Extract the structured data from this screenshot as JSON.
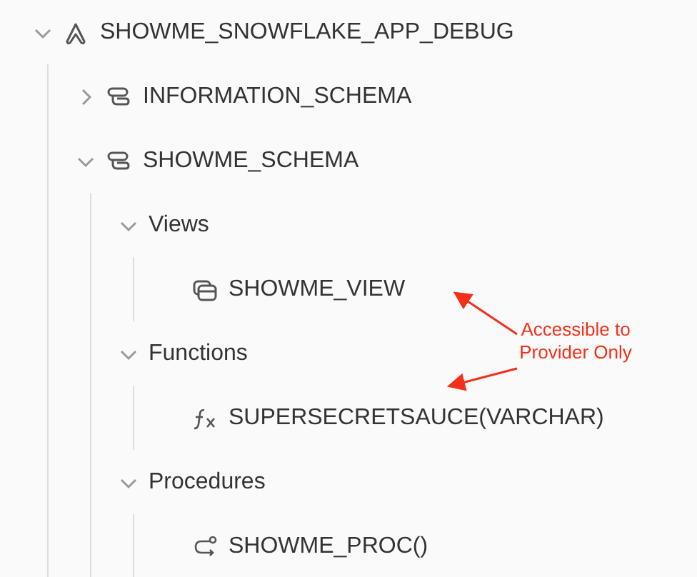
{
  "tree": [
    {
      "label": "SHOWME_SNOWFLAKE_APP_DEBUG",
      "kind": "app",
      "expanded": true,
      "children": [
        {
          "label": "INFORMATION_SCHEMA",
          "kind": "schema",
          "expanded": false
        },
        {
          "label": "SHOWME_SCHEMA",
          "kind": "schema",
          "expanded": true,
          "children": [
            {
              "label": "Views",
              "kind": "category",
              "expanded": true,
              "children": [
                {
                  "label": "SHOWME_VIEW",
                  "kind": "view"
                }
              ]
            },
            {
              "label": "Functions",
              "kind": "category",
              "expanded": true,
              "children": [
                {
                  "label": "SUPERSECRETSAUCE(VARCHAR)",
                  "kind": "function"
                }
              ]
            },
            {
              "label": "Procedures",
              "kind": "category",
              "expanded": true,
              "children": [
                {
                  "label": "SHOWME_PROC()",
                  "kind": "procedure"
                }
              ]
            }
          ]
        }
      ]
    }
  ],
  "annotation": {
    "text": "Accessible to Provider Only",
    "color": "#f5301a"
  }
}
